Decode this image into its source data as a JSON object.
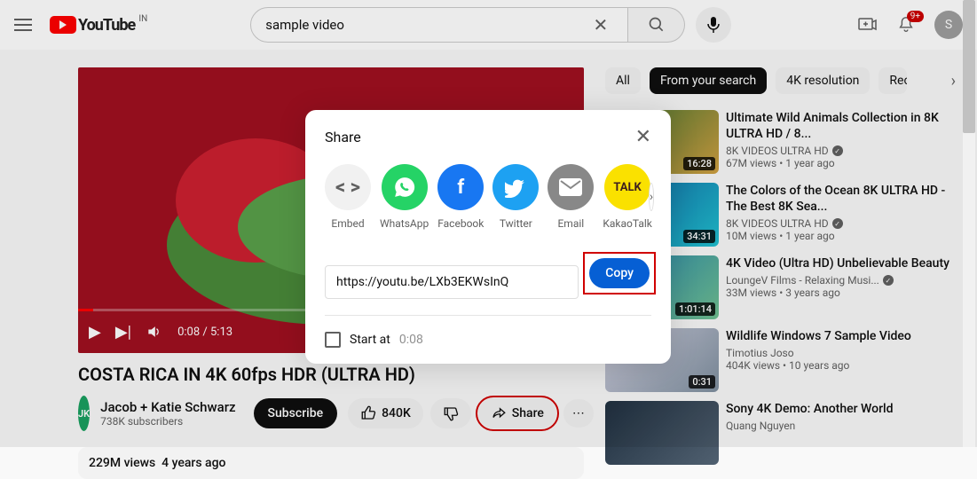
{
  "header": {
    "logo_text": "YouTube",
    "country": "IN",
    "search_value": "sample video",
    "notif_badge": "9+",
    "avatar_letter": "S"
  },
  "video": {
    "time_current": "0:08",
    "time_total": "5:13",
    "title": "COSTA RICA IN 4K 60fps HDR (ULTRA HD)",
    "channel": "Jacob + Katie Schwarz",
    "channel_avatar": "JK",
    "subscribers": "738K subscribers",
    "subscribe_label": "Subscribe",
    "likes": "840K",
    "share_label": "Share",
    "views": "229M views",
    "age": "4 years ago"
  },
  "chips": {
    "all": "All",
    "from": "From your search",
    "fourk": "4K resolution",
    "rec": "Rec"
  },
  "recs": [
    {
      "title": "Ultimate Wild Animals Collection in 8K ULTRA HD / 8...",
      "channel": "8K VIDEOS ULTRA HD",
      "verified": true,
      "views": "67M views",
      "age": "1 year ago",
      "duration": "16:28"
    },
    {
      "title": "The Colors of the Ocean 8K ULTRA HD - The Best 8K Sea...",
      "channel": "8K VIDEOS ULTRA HD",
      "verified": true,
      "views": "10M views",
      "age": "1 year ago",
      "duration": "34:31"
    },
    {
      "title": "4K Video (Ultra HD) Unbelievable Beauty",
      "channel": "LoungeV Films - Relaxing Musi...",
      "verified": true,
      "views": "33M views",
      "age": "3 years ago",
      "duration": "1:01:14"
    },
    {
      "title": "Wildlife Windows 7 Sample Video",
      "channel": "Timotius Joso",
      "verified": false,
      "views": "404K views",
      "age": "10 years ago",
      "duration": "0:31"
    },
    {
      "title": "Sony 4K Demo: Another World",
      "channel": "Quang Nguyen",
      "verified": false,
      "views": "",
      "age": "",
      "duration": ""
    }
  ],
  "share": {
    "title": "Share",
    "targets": {
      "embed": "Embed",
      "whatsapp": "WhatsApp",
      "facebook": "Facebook",
      "twitter": "Twitter",
      "email": "Email",
      "kakao": "KakaoTalk"
    },
    "url": "https://youtu.be/LXb3EKWsInQ",
    "copy_label": "Copy",
    "start_label": "Start at",
    "start_time": "0:08"
  }
}
